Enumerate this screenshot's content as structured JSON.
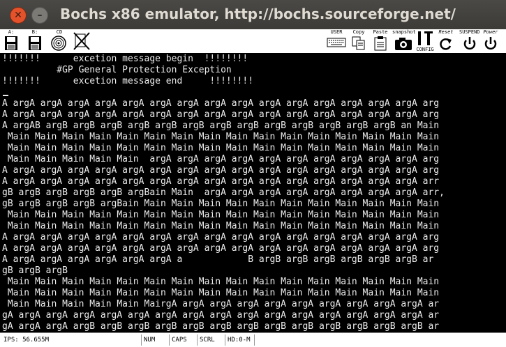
{
  "window": {
    "title": "Bochs x86 emulator, http://bochs.sourceforge.net/",
    "close_glyph": "✕",
    "minimize_glyph": "–"
  },
  "toolbar": {
    "floppy_a_label": "A:",
    "floppy_b_label": "B:",
    "cdrom_label": "CD",
    "user_label": "USER",
    "copy_label": "Copy",
    "paste_label": "Paste",
    "snapshot_label": "snapshot",
    "config_label": "CONFIG",
    "reset_label": "Reset",
    "suspend_label": "SUSPEND",
    "power_label": "Power"
  },
  "screen": {
    "lines": [
      "!!!!!!!      excetion message begin  !!!!!!!!",
      "          #GP General Protection Exception",
      "!!!!!!!      excetion message end     !!!!!!!!",
      "",
      "A argA argA argA argA argA argA argA argA argA argA argA argA argA argA argA arg",
      "A argA argA argA argA argA argA argA argA argA argA argA argA argA argA argA arg",
      "A argAB argB argB argB argB argB argB argB argB argB argB argB argB argB an Main",
      " Main Main Main Main Main Main Main Main Main Main Main Main Main Main Main Main",
      " Main Main Main Main Main Main Main Main Main Main Main Main Main Main Main Main",
      " Main Main Main Main Main  argA argA argA argA argA argA argA argA argA argA arg",
      "A argA argA argA argA argA argA argA argA argA argA argA argA argA argA argA arg",
      "A argA argA argA argA argA argA argA argA argA argA argA argA argA argA argA arr",
      "gB argB argB argB argB argBain Main  argA argA argA argA argA argA argA argA arr,",
      "gB argB argB argB argBain Main Main Main Main Main Main Main Main Main Main Main",
      " Main Main Main Main Main Main Main Main Main Main Main Main Main Main Main Main",
      " Main Main Main Main Main Main Main Main Main Main Main Main Main Main Main Main",
      "A argA argA argA argA argA argA argA argA argA argA argA argA argA argA argA arg",
      "A argA argA argA argA argA argA argA argA argA argA argA argA argA argA argA arg",
      "A argA argA argA argA argA argA a            B argB argB argB argB argB argB ar",
      "gB argB argB",
      " Main Main Main Main Main Main Main Main Main Main Main Main Main Main Main Main",
      " Main Main Main Main Main Main Main Main Main Main Main Main Main Main Main Main",
      " Main Main Main Main Main MairgA argA argA argA argA argA argA argA argA argA ar",
      "gA argA argA argA argA argA argA argA argA argA argA argA argA argA argA argA ar",
      "gA argA argA argB argB argB argB argB argB argB argB argB argB argB argB argB ar"
    ]
  },
  "status": {
    "ips": "IPS: 56.655M",
    "num": "NUM",
    "caps": "CAPS",
    "scrl": "SCRL",
    "hd": "HD:0-M"
  }
}
